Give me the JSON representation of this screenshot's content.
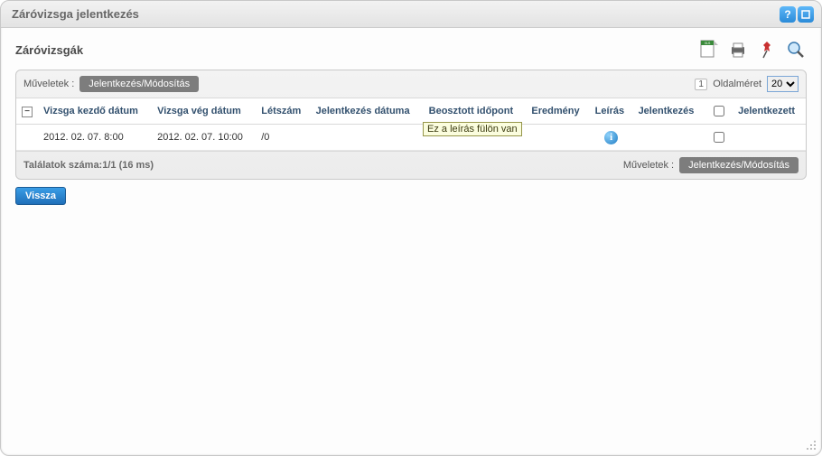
{
  "window": {
    "title": "Záróvizsga jelentkezés"
  },
  "page": {
    "heading": "Záróvizsgák"
  },
  "ops": {
    "label_top": "Műveletek :",
    "action_button": "Jelentkezés/Módosítás",
    "label_bottom": "Műveletek :"
  },
  "pager": {
    "page_number": "1",
    "size_label": "Oldalméret",
    "size_value": "20",
    "size_options": [
      "20"
    ]
  },
  "columns": {
    "c1": "Vizsga kezdő dátum",
    "c2": "Vizsga vég dátum",
    "c3": "Létszám",
    "c4": "Jelentkezés dátuma",
    "c5": "Beosztott időpont",
    "c6": "Eredmény",
    "c7": "Leírás",
    "c8": "Jelentkezés",
    "c9": "Jelentkezett"
  },
  "rows": [
    {
      "start": "2012. 02. 07. 8:00",
      "end": "2012. 02. 07. 10:00",
      "count": "/0",
      "reg_date": "",
      "scheduled": "",
      "result": "",
      "desc_icon": "info",
      "signup_checked": false
    }
  ],
  "tooltip": "Ez a leírás fülön van",
  "footer": {
    "results": "Találatok száma:1/1 (16 ms)"
  },
  "buttons": {
    "back": "Vissza"
  },
  "icons": {
    "help": "?",
    "maximize": "□",
    "xls": "xls",
    "print": "print",
    "pin": "pin",
    "search": "search",
    "info": "i"
  }
}
